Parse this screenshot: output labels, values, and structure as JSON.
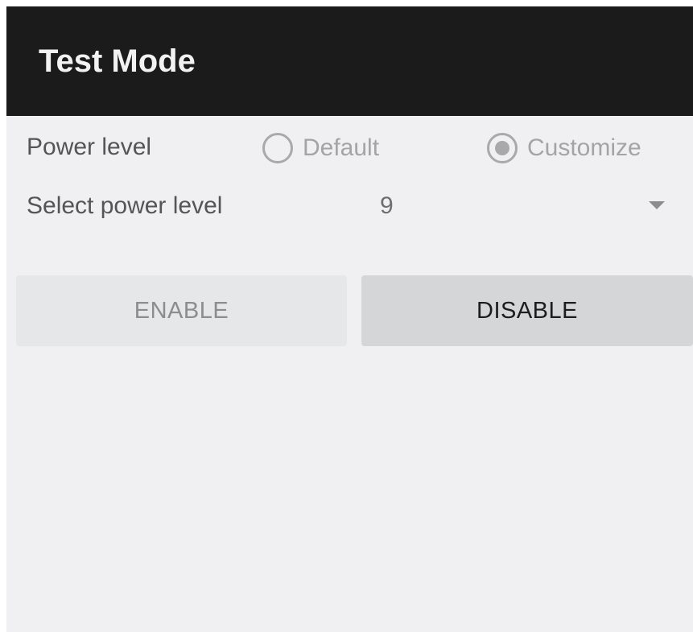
{
  "toolbar": {
    "title": "Test Mode",
    "background_color": "#1b1b1c"
  },
  "power_level": {
    "label": "Power level",
    "options": [
      {
        "label": "Default",
        "checked": false
      },
      {
        "label": "Customize",
        "checked": true
      }
    ]
  },
  "select_power_level": {
    "label": "Select power level",
    "value": "9",
    "icon": "dropdown-arrow-icon"
  },
  "buttons": {
    "enable_label": "ENABLE",
    "disable_label": "DISABLE"
  }
}
